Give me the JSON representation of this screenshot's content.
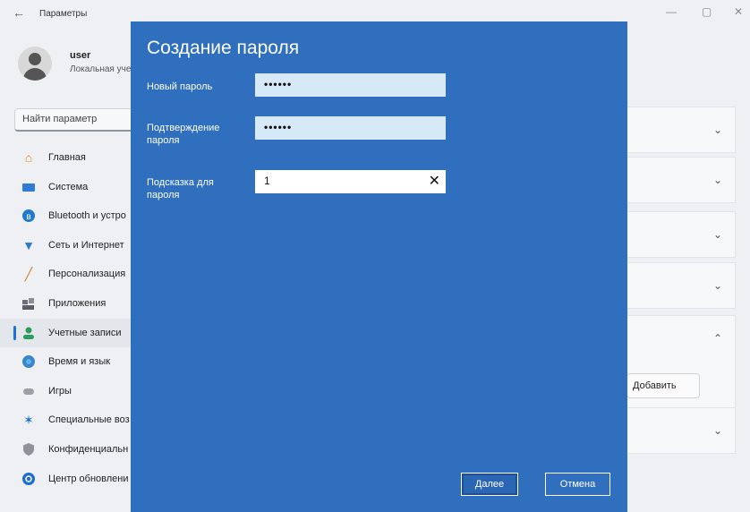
{
  "titlebar": {
    "title": "Параметры",
    "back_icon": "←",
    "minimize_icon": "—",
    "maximize_icon": "▢",
    "close_icon": "✕"
  },
  "user": {
    "name": "user",
    "subtitle": "Локальная учет"
  },
  "search": {
    "placeholder": "Найти параметр"
  },
  "nav": {
    "items": [
      {
        "label": "Главная",
        "icon": "home-icon"
      },
      {
        "label": "Система",
        "icon": "system-icon"
      },
      {
        "label": "Bluetooth и устро",
        "icon": "bluetooth-icon"
      },
      {
        "label": "Сеть и Интернет",
        "icon": "network-icon"
      },
      {
        "label": "Персонализация",
        "icon": "brush-icon"
      },
      {
        "label": "Приложения",
        "icon": "apps-icon"
      },
      {
        "label": "Учетные записи",
        "icon": "accounts-icon"
      },
      {
        "label": "Время и язык",
        "icon": "time-language-icon"
      },
      {
        "label": "Игры",
        "icon": "gaming-icon"
      },
      {
        "label": "Специальные воз",
        "icon": "accessibility-icon"
      },
      {
        "label": "Конфиденциальн",
        "icon": "privacy-icon"
      },
      {
        "label": "Центр обновлени",
        "icon": "update-icon"
      }
    ],
    "selected_index": 6
  },
  "right_panel": {
    "add_button": "Добавить",
    "chevron_down": "⌄",
    "chevron_up": "⌃"
  },
  "dialog": {
    "title": "Создание пароля",
    "new_password_label": "Новый пароль",
    "new_password_value": "••••••",
    "confirm_label": "Подтверждение пароля",
    "confirm_value": "••••••",
    "hint_label": "Подсказка для пароля",
    "hint_value": "1",
    "clear_icon": "✕",
    "next_button": "Далее",
    "cancel_button": "Отмена"
  },
  "colors": {
    "dialog_bg": "#2f6fbe",
    "accent": "#1a73d9"
  }
}
